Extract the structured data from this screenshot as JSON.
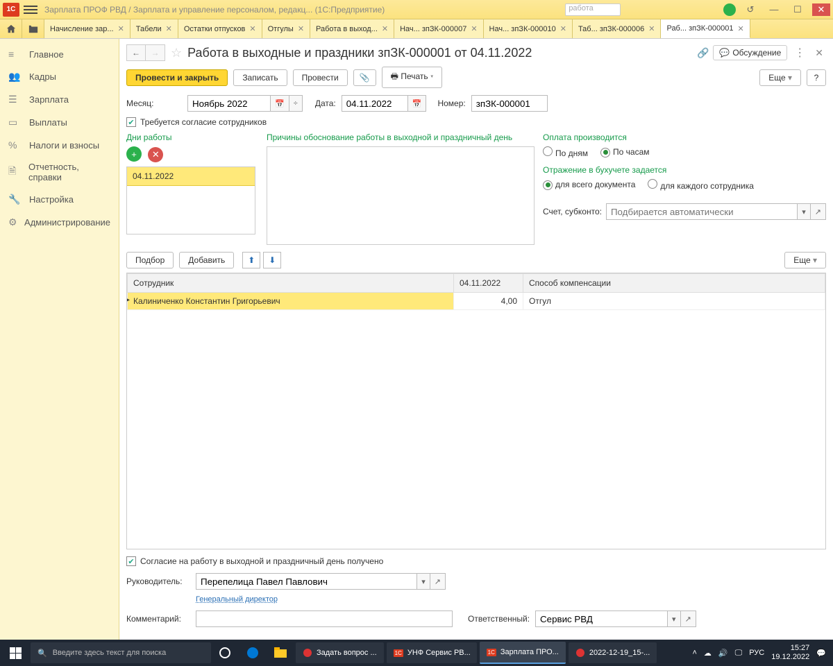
{
  "titlebar": {
    "logo": "1C",
    "text": "Зарплата ПРОФ РВД / Зарплата и управление персоналом, редакц... (1С:Предприятие)",
    "search_placeholder": "работа"
  },
  "tabs": {
    "items": [
      {
        "label": "Начисление зар..."
      },
      {
        "label": "Табели"
      },
      {
        "label": "Остатки отпусков"
      },
      {
        "label": "Отгулы"
      },
      {
        "label": "Работа в выход..."
      },
      {
        "label": "Нач... зпЗК-000007"
      },
      {
        "label": "Нач... зпЗК-000010"
      },
      {
        "label": "Таб... зпЗК-000006"
      },
      {
        "label": "Раб... зпЗК-000001"
      }
    ]
  },
  "sidebar": {
    "items": [
      {
        "icon": "≡",
        "label": "Главное"
      },
      {
        "icon": "👥",
        "label": "Кадры"
      },
      {
        "icon": "🗂",
        "label": "Зарплата"
      },
      {
        "icon": "💳",
        "label": "Выплаты"
      },
      {
        "icon": "%",
        "label": "Налоги и взносы"
      },
      {
        "icon": "🗎",
        "label": "Отчетность, справки"
      },
      {
        "icon": "🔧",
        "label": "Настройка"
      },
      {
        "icon": "⚙",
        "label": "Администрирование"
      }
    ]
  },
  "doc": {
    "title": "Работа в выходные и праздники зпЗК-000001 от 04.11.2022",
    "discuss": "Обсуждение",
    "toolbar": {
      "post_close": "Провести и закрыть",
      "save": "Записать",
      "post": "Провести",
      "print": "Печать",
      "more": "Еще"
    },
    "month_label": "Месяц:",
    "month_value": "Ноябрь 2022",
    "date_label": "Дата:",
    "date_value": "04.11.2022",
    "number_label": "Номер:",
    "number_value": "зпЗК-000001",
    "consent_required": "Требуется согласие сотрудников",
    "work_days_label": "Дни работы",
    "reason_label": "Причины обоснование работы в выходной и праздничный день",
    "work_days": [
      "04.11.2022"
    ],
    "payment_label": "Оплата производится",
    "by_days": "По дням",
    "by_hours": "По часам",
    "accounting_label": "Отражение в бухучете задается",
    "acc_whole": "для всего документа",
    "acc_each": "для каждого сотрудника",
    "account_label": "Счет, субконто:",
    "account_placeholder": "Подбирается автоматически",
    "select_btn": "Подбор",
    "add_btn": "Добавить",
    "more2": "Еще",
    "table": {
      "cols": [
        "Сотрудник",
        "04.11.2022",
        "Способ компенсации"
      ],
      "rows": [
        {
          "employee": "Калиниченко Константин Григорьевич",
          "hours": "4,00",
          "comp": "Отгул"
        }
      ]
    },
    "consent_received": "Согласие на работу в выходной и праздничный день получено",
    "manager_label": "Руководитель:",
    "manager_value": "Перепелица Павел Павлович",
    "manager_title": "Генеральный директор",
    "comment_label": "Комментарий:",
    "responsible_label": "Ответственный:",
    "responsible_value": "Сервис РВД"
  },
  "taskbar": {
    "search_placeholder": "Введите здесь текст для поиска",
    "tasks": [
      {
        "label": "Задать вопрос ..."
      },
      {
        "label": "УНФ Сервис РВ..."
      },
      {
        "label": "Зарплата ПРО...",
        "active": true
      },
      {
        "label": "2022-12-19_15-..."
      }
    ],
    "lang": "РУС",
    "time": "15:27",
    "date": "19.12.2022"
  }
}
